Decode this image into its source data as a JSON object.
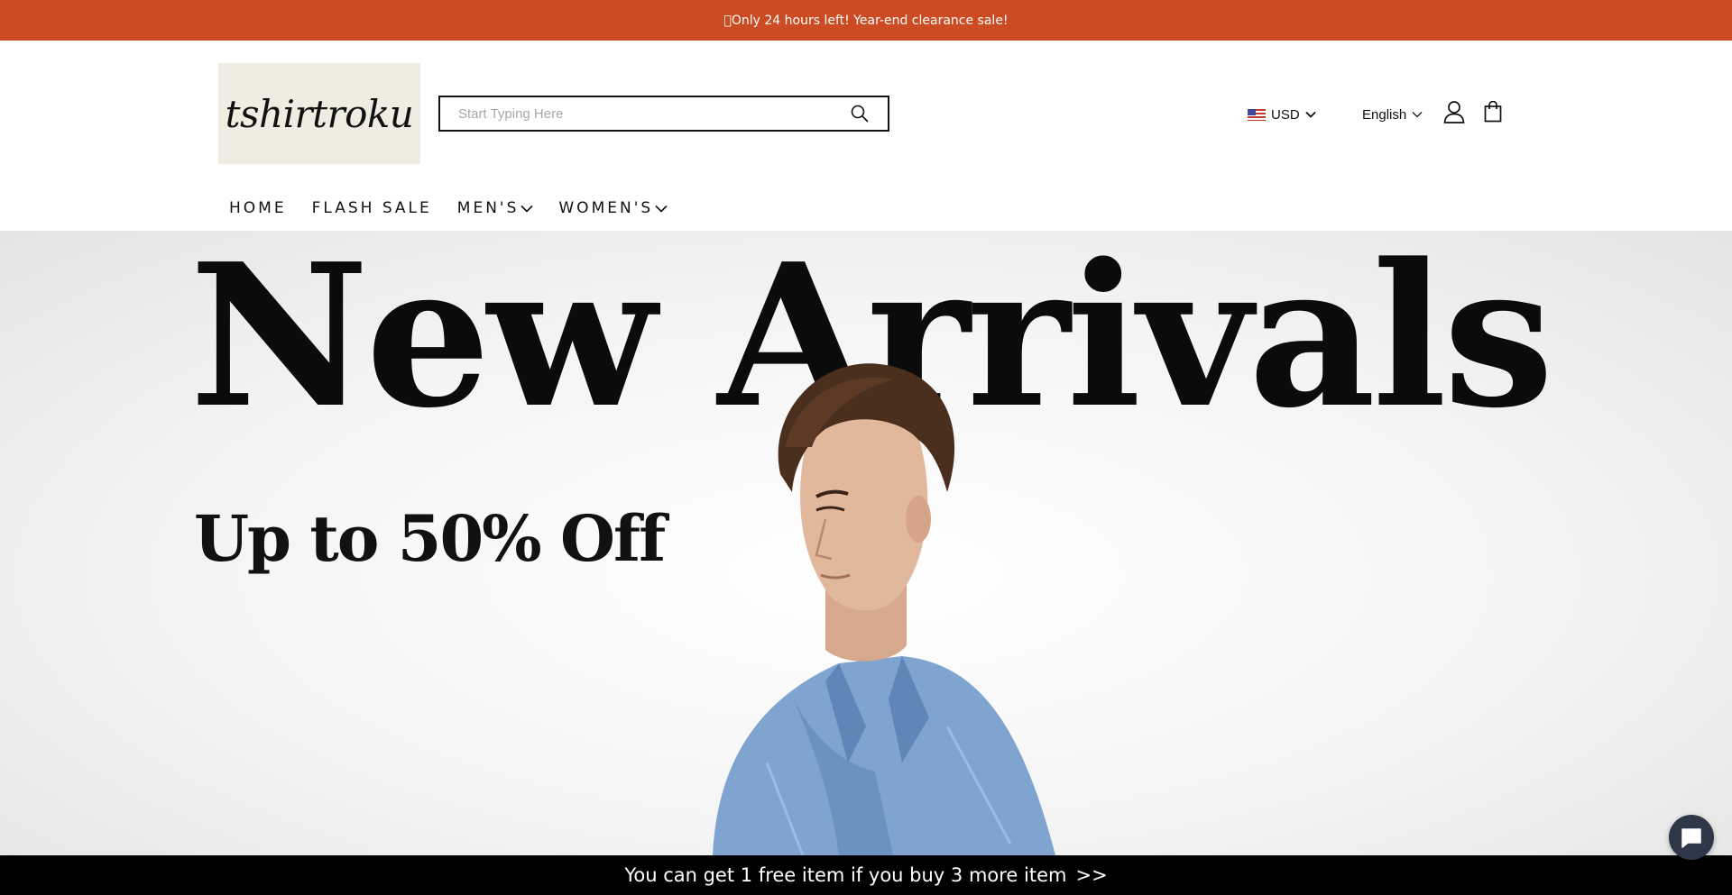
{
  "announcement": {
    "text": "􏿽Only 24 hours left! Year-end clearance sale!",
    "bg_color": "#cc4b23"
  },
  "header": {
    "logo_text": "tshirtroku",
    "search": {
      "placeholder": "Start Typing Here",
      "icon": "search-icon"
    },
    "currency": {
      "flag": "us-flag-icon",
      "label": "USD"
    },
    "language": {
      "label": "English"
    },
    "account_icon": "user-icon",
    "cart_icon": "shopping-bag-icon"
  },
  "nav": {
    "items": [
      {
        "label": "HOME",
        "has_dropdown": false
      },
      {
        "label": "FLASH SALE",
        "has_dropdown": false
      },
      {
        "label": "MEN'S",
        "has_dropdown": true
      },
      {
        "label": "WOMEN'S",
        "has_dropdown": true
      }
    ]
  },
  "hero": {
    "title": "New Arrivals",
    "subtitle": "Up to 50% Off",
    "image": "man-in-denim-jacket"
  },
  "promo_bar": {
    "text": "You can get 1 free item if you buy 3 more item",
    "arrow": ">>"
  },
  "chat": {
    "icon": "chat-bubble-icon",
    "color": "#2e3748"
  }
}
